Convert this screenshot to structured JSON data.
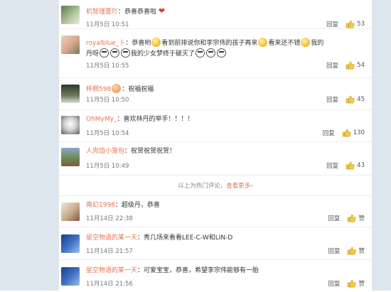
{
  "comments_hot": [
    {
      "user": "机智瑾夏吖",
      "text": "：恭喜恭喜啦",
      "time": "11月5日 10:51",
      "reply": "回复",
      "likes": "53",
      "emoji": "heart"
    },
    {
      "user": "royalblue_卜",
      "text1": "：恭喜哟",
      "text2": "看到前排说你和李宗伟的孩子再来",
      "text3": "看来还不错",
      "text4": "我的",
      "text5": "丹呀",
      "text6": "我的少女梦终于破灭了",
      "time": "11月5日 10:55",
      "reply": "回复",
      "likes": "54"
    },
    {
      "user": "梓桐598",
      "text": "：祝福祝福",
      "time": "11月5日 10:50",
      "reply": "回复",
      "likes": "45"
    },
    {
      "user": "OhMyMy_",
      "text": "：喜欢林丹的举手！！！！",
      "time": "11月5日 10:54",
      "reply": "回复",
      "likes": "130"
    },
    {
      "user": "人肉馅小笼包",
      "text": "：祝贺祝贺祝贺！",
      "time": "11月5日 10:49",
      "reply": "回复",
      "likes": "43"
    }
  ],
  "hot_divider": {
    "text": "以上为热门评论，",
    "link": "查看更多"
  },
  "comments_new": [
    {
      "user": "南幻1998",
      "text": "：超级丹，恭喜",
      "time": "11月14日 22:38",
      "reply": "回复",
      "likes": "赞"
    },
    {
      "user": "星空物语的某一天",
      "text": "：秀几场来看看LEE-C-W和LIN-D",
      "time": "11月14日 21:57",
      "reply": "回复",
      "likes": "赞"
    },
    {
      "user": "星空物语的某一天",
      "text": "：可爱宝宝，恭喜，希望李宗伟能够有一胎",
      "time": "11月14日 21:56",
      "reply": "回复",
      "likes": "赞"
    }
  ],
  "colors": {
    "username": "#eb7350",
    "frame": "#dde6ee"
  },
  "icons": {
    "like": "thumbs-up-icon"
  }
}
